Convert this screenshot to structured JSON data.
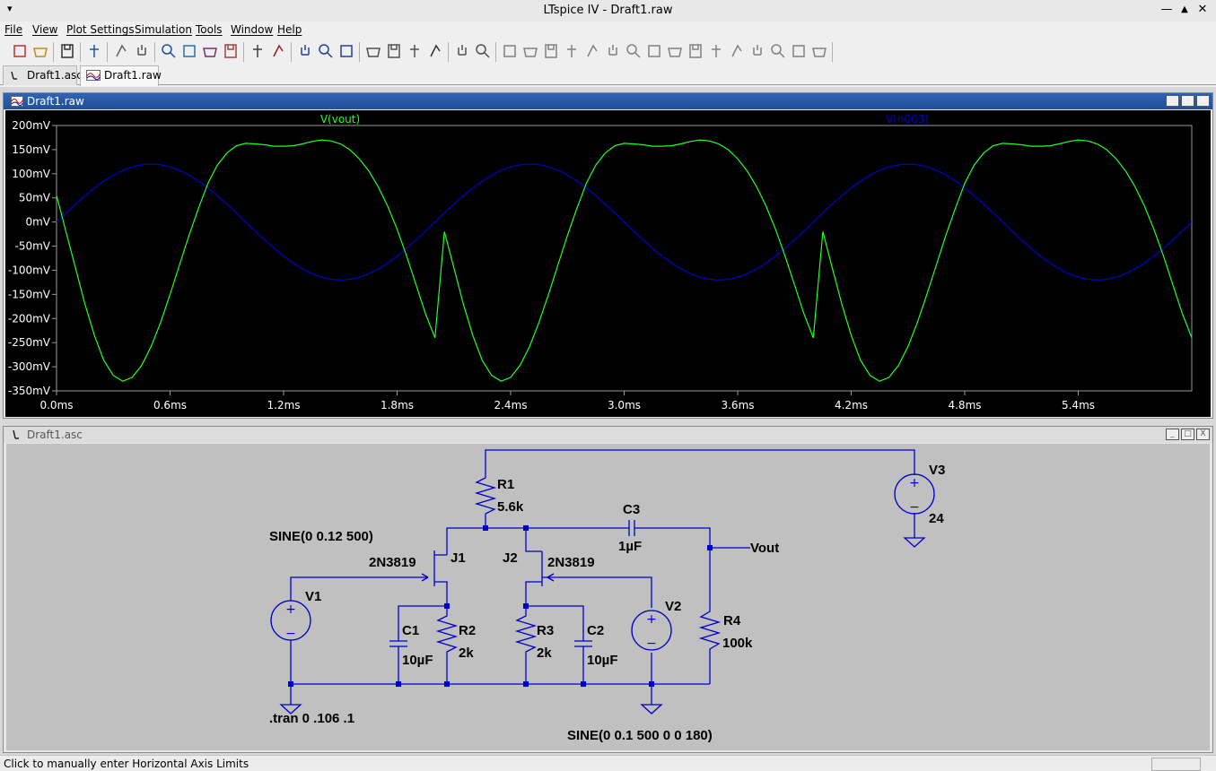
{
  "window": {
    "title": "LTspice IV - Draft1.raw",
    "menu_glyph": "▾",
    "min_glyph": "—",
    "max_glyph": "▲",
    "close_glyph": "✕"
  },
  "menu": [
    "File",
    "View",
    "Plot Settings",
    "Simulation",
    "Tools",
    "Window",
    "Help"
  ],
  "toolbar_icons": [
    "new-schematic",
    "open",
    "save",
    "control-panel",
    "run",
    "halt",
    "zoom-in",
    "zoom-area",
    "zoom-out",
    "zoom-cancel",
    "autorange",
    "zoom-full",
    "tile-horizontal",
    "cascade",
    "tile-vertical",
    "cut",
    "copy",
    "paste",
    "find",
    "print-setup",
    "print",
    "wire",
    "ground",
    "label-net",
    "resistor",
    "capacitor",
    "inductor",
    "diode",
    "component",
    "move",
    "drag",
    "undo",
    "redo",
    "rotate",
    "mirror",
    "text",
    "spice-directive"
  ],
  "tabs": [
    {
      "label": "Draft1.asc",
      "active": false,
      "icon": "schematic-icon"
    },
    {
      "label": "Draft1.raw",
      "active": true,
      "icon": "waveform-icon"
    }
  ],
  "plot_window": {
    "title": "Draft1.raw",
    "min": "_",
    "max": "□",
    "close": "X"
  },
  "schematic_window": {
    "title": "Draft1.asc",
    "min": "_",
    "max": "□",
    "close": "X"
  },
  "colors": {
    "vout": "#22ff22",
    "n003": "#0000d0",
    "wire": "#0000c8",
    "plot_bg": "#000000",
    "axis_text": "#ffffff",
    "frame": "#9a9a9a",
    "title_active": "#2a5aa8",
    "sch_bg": "#c0c0c0"
  },
  "chart_data": {
    "type": "line",
    "title": "",
    "xlabel": "",
    "ylabel": "",
    "xlim": [
      0,
      6.0
    ],
    "ylim": [
      -350,
      200
    ],
    "x_unit": "ms",
    "y_unit": "mV",
    "x_ticks": [
      "0.0ms",
      "0.6ms",
      "1.2ms",
      "1.8ms",
      "2.4ms",
      "3.0ms",
      "3.6ms",
      "4.2ms",
      "4.8ms",
      "5.4ms"
    ],
    "y_ticks": [
      "200mV",
      "150mV",
      "100mV",
      "50mV",
      "0mV",
      "-50mV",
      "-100mV",
      "-150mV",
      "-200mV",
      "-250mV",
      "-300mV",
      "-350mV"
    ],
    "series": [
      {
        "name": "V(vout)",
        "x": [
          0.0,
          0.05,
          0.1,
          0.15,
          0.2,
          0.25,
          0.3,
          0.35,
          0.4,
          0.45,
          0.5,
          0.55,
          0.6,
          0.65,
          0.7,
          0.75,
          0.8,
          0.85,
          0.9,
          0.95,
          1.0,
          1.05,
          1.1,
          1.15,
          1.2,
          1.25,
          1.3,
          1.35,
          1.4,
          1.45,
          1.5,
          1.55,
          1.6,
          1.65,
          1.7,
          1.75,
          1.8,
          1.85,
          1.9,
          1.95,
          2.0
        ],
        "y": [
          55,
          -20,
          -95,
          -170,
          -235,
          -287,
          -318,
          -330,
          -322,
          -297,
          -258,
          -208,
          -150,
          -89,
          -28,
          28,
          80,
          118,
          143,
          158,
          163,
          162,
          160,
          157,
          157,
          158,
          162,
          167,
          170,
          168,
          162,
          150,
          131,
          106,
          73,
          33,
          -15,
          -70,
          -130,
          -190,
          -240
        ]
      },
      {
        "name": "V(n003)",
        "amplitude": 120,
        "frequency_khz": 0.5,
        "phase_deg": 0
      }
    ]
  },
  "schematic": {
    "labels": {
      "R1": "R1",
      "R1_val": "5.6k",
      "R2": "R2",
      "R2_val": "2k",
      "R3": "R3",
      "R3_val": "2k",
      "R4": "R4",
      "R4_val": "100k",
      "C1": "C1",
      "C1_val": "10µF",
      "C2": "C2",
      "C2_val": "10µF",
      "C3": "C3",
      "C3_val": "1µF",
      "J1": "J1",
      "J1_model": "2N3819",
      "J2": "J2",
      "J2_model": "2N3819",
      "V1": "V1",
      "V1_val": "SINE(0 0.12 500)",
      "V2": "V2",
      "V2_val": "SINE(0 0.1 500 0 0 180)",
      "V3": "V3",
      "V3_val": "24",
      "vout": "Vout",
      "tran": ".tran 0 .106 .1",
      "plus": "+",
      "minus": "−"
    }
  },
  "status": {
    "text": "Click to manually enter Horizontal Axis Limits"
  }
}
